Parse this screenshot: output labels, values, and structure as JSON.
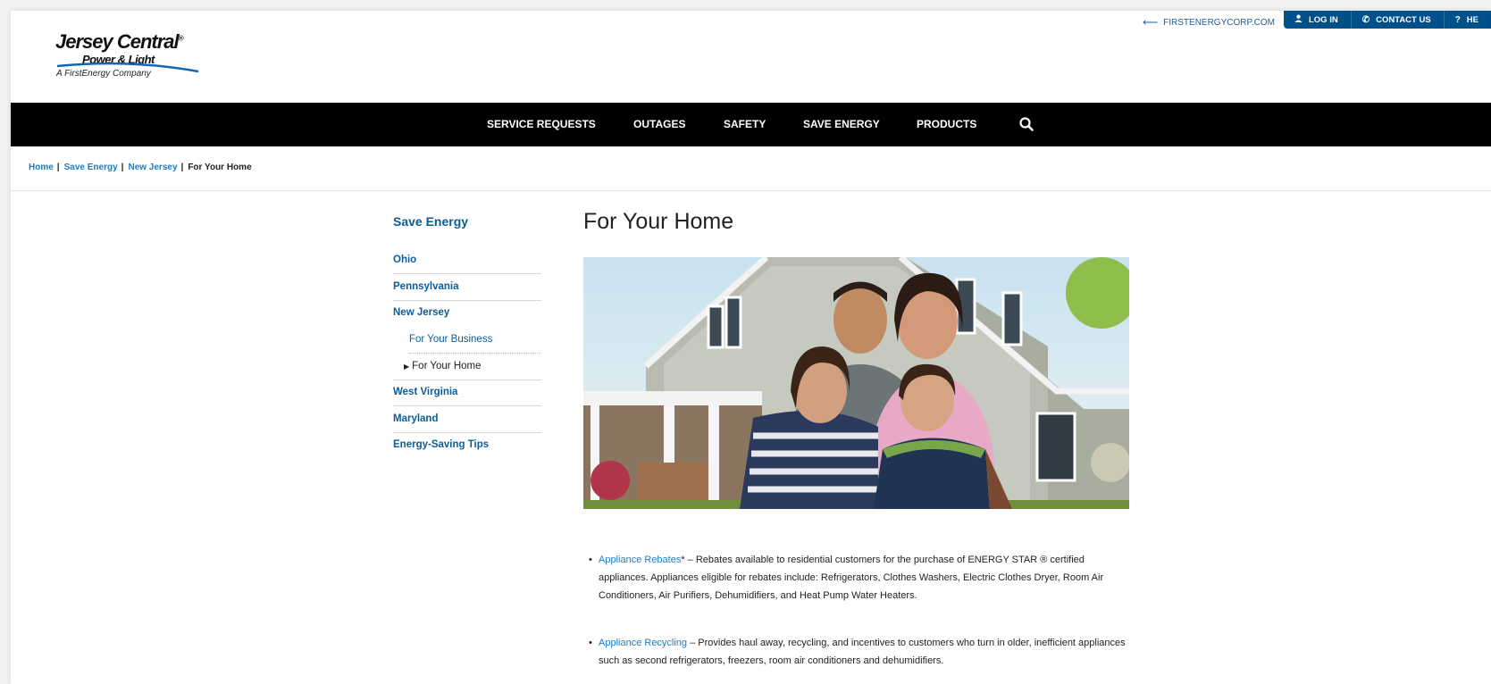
{
  "logo": {
    "line1": "Jersey Central",
    "trademark": "®",
    "line2": "Power & Light",
    "line3": "A FirstEnergy Company"
  },
  "utility": {
    "firstenergy_link": "FIRSTENERGYCORP.COM",
    "login": "LOG IN",
    "contact": "CONTACT US",
    "help": "HE"
  },
  "nav": {
    "items": [
      "SERVICE REQUESTS",
      "OUTAGES",
      "SAFETY",
      "SAVE ENERGY",
      "PRODUCTS"
    ]
  },
  "breadcrumb": {
    "items": [
      "Home",
      "Save Energy",
      "New Jersey"
    ],
    "separator": "|",
    "current": "For Your Home"
  },
  "sidebar": {
    "title": "Save Energy",
    "items": [
      "Ohio",
      "Pennsylvania",
      "New Jersey",
      "West Virginia",
      "Maryland",
      "Energy-Saving Tips"
    ],
    "sub_items": [
      "For Your Business",
      "For Your Home"
    ]
  },
  "main": {
    "title": "For Your Home",
    "bullets": [
      {
        "link": "Appliance Rebates",
        "text": "* – Rebates available to residential customers for the purchase of ENERGY STAR ® certified appliances.  Appliances eligible for rebates include:  Refrigerators, Clothes Washers, Electric Clothes Dryer, Room Air Conditioners, Air Purifiers, Dehumidifiers, and Heat Pump Water Heaters."
      },
      {
        "link": "Appliance Recycling",
        "text": " – Provides haul away, recycling, and incentives to customers who turn in older, inefficient appliances such as second refrigerators, freezers, room air conditioners and dehumidifiers."
      }
    ]
  },
  "colors": {
    "nav_bg": "#000000",
    "brand_blue": "#0b5c97",
    "link_blue": "#1a7dc9",
    "utility_bg": "#00508a"
  }
}
